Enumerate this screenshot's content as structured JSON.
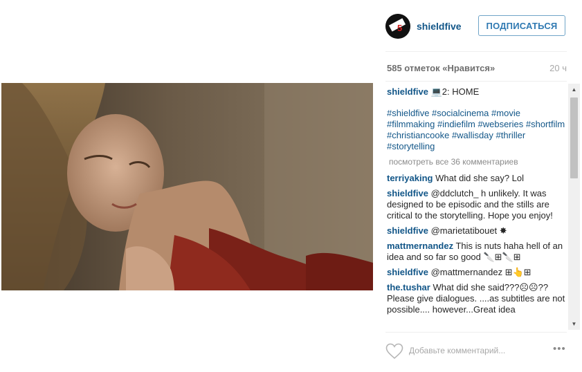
{
  "post": {
    "username": "shieldfive",
    "avatar_text": "SHIELD 5",
    "follow_label": "ПОДПИСАТЬСЯ",
    "likes_text": "585 отметок «Нравится»",
    "time_ago": "20 ч"
  },
  "caption": {
    "user": "shieldfive",
    "text": "💻2: HOME",
    "hashtags": "#shieldfive #socialcinema #movie #filmmaking #indiefilm #webseries #shortfilm #christiancooke #wallisday #thriller #storytelling"
  },
  "view_all_comments": "посмотреть все 36 комментариев",
  "comments": [
    {
      "user": "terriyaking",
      "text": "What did she say? Lol"
    },
    {
      "user": "shieldfive",
      "text": "@ddclutch_ h unlikely. It was designed to be episodic and the stills are critical to the storytelling. Hope you enjoy!"
    },
    {
      "user": "shieldfive",
      "text": "@marietatibouet ✸"
    },
    {
      "user": "mattmernandez",
      "text": "This is nuts haha hell of an idea and so far so good 🔪⊞🔪⊞"
    },
    {
      "user": "shieldfive",
      "text": "@mattmernandez ⊞👆⊞"
    },
    {
      "user": "the.tushar",
      "text": "What did she said???☹☹?? Please give dialogues. ....as subtitles are not possible.... however...Great idea"
    }
  ],
  "footer": {
    "add_comment_placeholder": "Добавьте комментарий...",
    "more_label": "•••",
    "heart_icon": "heart-outline-icon"
  },
  "colors": {
    "username_blue": "#125688",
    "follow_border": "#6fa4c8",
    "muted_gray": "#a8a8a8"
  }
}
